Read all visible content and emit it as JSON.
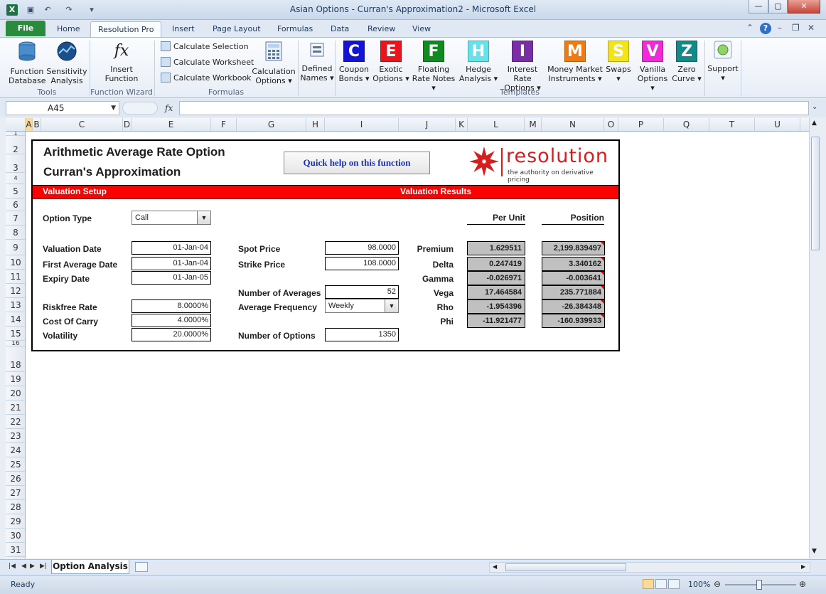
{
  "window": {
    "title": "Asian Options - Curran's Approximation2  -  Microsoft Excel"
  },
  "ribbon": {
    "tabs": [
      {
        "label": "File"
      },
      {
        "label": "Home"
      },
      {
        "label": "Resolution Pro"
      },
      {
        "label": "Insert"
      },
      {
        "label": "Page Layout"
      },
      {
        "label": "Formulas"
      },
      {
        "label": "Data"
      },
      {
        "label": "Review"
      },
      {
        "label": "View"
      }
    ],
    "groups": {
      "tools": "Tools",
      "function_wizard": "Function Wizard",
      "formulas": "Formulas",
      "templates": "Templates"
    },
    "buttons": {
      "function_database_1": "Function",
      "function_database_2": "Database",
      "sensitivity_1": "Sensitivity",
      "sensitivity_2": "Analysis",
      "insert_function_1": "Insert",
      "insert_function_2": "Function",
      "calc_selection": "Calculate Selection",
      "calc_worksheet": "Calculate Worksheet",
      "calc_workbook": "Calculate Workbook",
      "calc_options_1": "Calculation",
      "calc_options_2": "Options ▾",
      "defined_names_1": "Defined",
      "defined_names_2": "Names ▾",
      "support": "Support"
    },
    "templates": [
      {
        "letter": "C",
        "line1": "Coupon",
        "line2": "Bonds ▾",
        "color": "#1414d6"
      },
      {
        "letter": "E",
        "line1": "Exotic",
        "line2": "Options ▾",
        "color": "#e8141e"
      },
      {
        "letter": "F",
        "line1": "Floating",
        "line2": "Rate Notes ▾",
        "color": "#128a22"
      },
      {
        "letter": "H",
        "line1": "Hedge",
        "line2": "Analysis ▾",
        "color": "#66e3ea"
      },
      {
        "letter": "I",
        "line1": "Interest Rate",
        "line2": "Options ▾",
        "color": "#7a2ea6"
      },
      {
        "letter": "M",
        "line1": "Money Market",
        "line2": "Instruments ▾",
        "color": "#f07a12"
      },
      {
        "letter": "S",
        "line1": "Swaps",
        "line2": "▾",
        "color": "#f2e41a"
      },
      {
        "letter": "V",
        "line1": "Vanilla",
        "line2": "Options ▾",
        "color": "#ee2bd6"
      },
      {
        "letter": "Z",
        "line1": "Zero",
        "line2": "Curve ▾",
        "color": "#138a8a"
      }
    ]
  },
  "formula_bar": {
    "name_box": "A45",
    "fx": "fx",
    "formula": ""
  },
  "columns": [
    "A",
    "B",
    "C",
    "D",
    "E",
    "F",
    "G",
    "H",
    "I",
    "J",
    "K",
    "L",
    "M",
    "N",
    "O",
    "P",
    "Q",
    "T",
    "U"
  ],
  "rows": [
    "1",
    "2",
    "3",
    "4",
    "5",
    "6",
    "7",
    "8",
    "9",
    "10",
    "11",
    "12",
    "13",
    "14",
    "15",
    "16",
    "18",
    "19",
    "20",
    "21",
    "22",
    "23",
    "24",
    "25",
    "26",
    "27",
    "28",
    "29",
    "30",
    "31"
  ],
  "model": {
    "title1": "Arithmetic Average Rate Option",
    "title2": "Curran's Approximation",
    "help_button": "Quick help on this function",
    "logo_word": "resolution",
    "logo_tagline": "the authority on derivative pricing",
    "valuation_setup": "Valuation Setup",
    "valuation_results": "Valuation Results",
    "option_type_label": "Option Type",
    "option_type_value": "Call",
    "valuation_date_label": "Valuation Date",
    "valuation_date": "01-Jan-04",
    "first_avg_date_label": "First Average Date",
    "first_avg_date": "01-Jan-04",
    "expiry_date_label": "Expiry Date",
    "expiry_date": "01-Jan-05",
    "riskfree_label": "Riskfree Rate",
    "riskfree": "8.0000%",
    "carry_label": "Cost Of Carry",
    "carry": "4.0000%",
    "vol_label": "Volatility",
    "vol": "20.0000%",
    "spot_label": "Spot Price",
    "spot": "98.0000",
    "strike_label": "Strike Price",
    "strike": "108.0000",
    "num_avg_label": "Number of Averages",
    "num_avg": "52",
    "avg_freq_label": "Average Frequency",
    "avg_freq": "Weekly",
    "num_options_label": "Number of Options",
    "num_options": "1350",
    "per_unit_header": "Per Unit",
    "position_header": "Position",
    "results": [
      {
        "label": "Premium",
        "per_unit": "1.629511",
        "position": "2,199.839497"
      },
      {
        "label": "Delta",
        "per_unit": "0.247419",
        "position": "3.340162"
      },
      {
        "label": "Gamma",
        "per_unit": "-0.026971",
        "position": "-0.003641"
      },
      {
        "label": "Vega",
        "per_unit": "17.464584",
        "position": "235.771884"
      },
      {
        "label": "Rho",
        "per_unit": "-1.954396",
        "position": "-26.384348"
      },
      {
        "label": "Phi",
        "per_unit": "-11.921477",
        "position": "-160.939933"
      }
    ]
  },
  "sheet_tab": "Option Analysis",
  "status": {
    "ready": "Ready",
    "zoom": "100%"
  }
}
